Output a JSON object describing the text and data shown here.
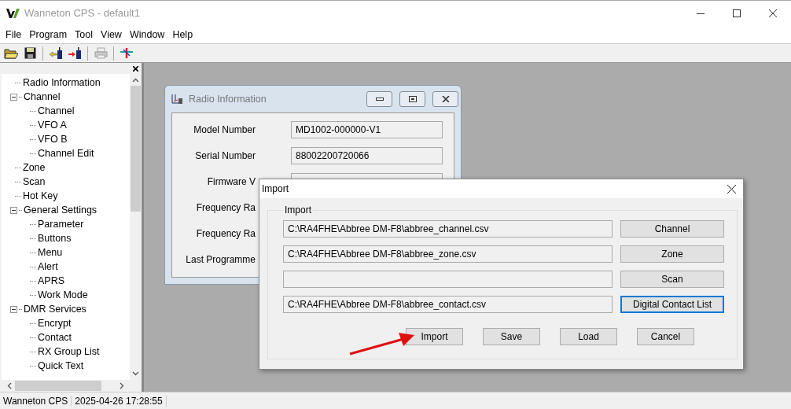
{
  "window": {
    "title": "Wanneton CPS - default1"
  },
  "menu": [
    "File",
    "Program",
    "Tool",
    "View",
    "Window",
    "Help"
  ],
  "tree": [
    {
      "label": "Radio Information"
    },
    {
      "label": "Channel",
      "expanded": true,
      "children": [
        {
          "label": "Channel"
        },
        {
          "label": "VFO A"
        },
        {
          "label": "VFO B"
        },
        {
          "label": "Channel Edit"
        }
      ]
    },
    {
      "label": "Zone"
    },
    {
      "label": "Scan"
    },
    {
      "label": "Hot Key"
    },
    {
      "label": "General Settings",
      "expanded": true,
      "children": [
        {
          "label": "Parameter"
        },
        {
          "label": "Buttons"
        },
        {
          "label": "Menu"
        },
        {
          "label": "Alert"
        },
        {
          "label": "APRS"
        },
        {
          "label": "Work Mode"
        }
      ]
    },
    {
      "label": "DMR Services",
      "expanded": true,
      "children": [
        {
          "label": "Encrypt"
        },
        {
          "label": "Contact"
        },
        {
          "label": "RX Group List"
        },
        {
          "label": "Quick Text"
        }
      ]
    }
  ],
  "radio_information": {
    "title": "Radio Information",
    "fields": [
      {
        "kind": "field",
        "label": "Model Number",
        "value": "MD1002-000000-V1"
      },
      {
        "kind": "field",
        "label": "Serial Number",
        "value": "88002200720066"
      },
      {
        "kind": "field",
        "label": "Firmware V"
      },
      {
        "kind": "label",
        "label": "Frequency Ra"
      },
      {
        "kind": "label",
        "label": "Frequency Ra"
      },
      {
        "kind": "label",
        "label": "Last Programme"
      }
    ]
  },
  "import_dialog": {
    "title": "Import",
    "group": "Import",
    "rows": [
      {
        "path": "C:\\RA4FHE\\Abbree DM-F8\\abbree_channel.csv",
        "button": "Channel",
        "focused": false
      },
      {
        "path": "C:\\RA4FHE\\Abbree DM-F8\\abbree_zone.csv",
        "button": "Zone",
        "focused": false
      },
      {
        "button": "Scan",
        "focused": false
      },
      {
        "path": "C:\\RA4FHE\\Abbree DM-F8\\abbree_contact.csv",
        "button": "Digital Contact List",
        "focused": true
      }
    ],
    "buttons": [
      "Import",
      "Save",
      "Load",
      "Cancel"
    ]
  },
  "status_bar": [
    "Wanneton CPS",
    "2025-04-26 17:28:55"
  ]
}
